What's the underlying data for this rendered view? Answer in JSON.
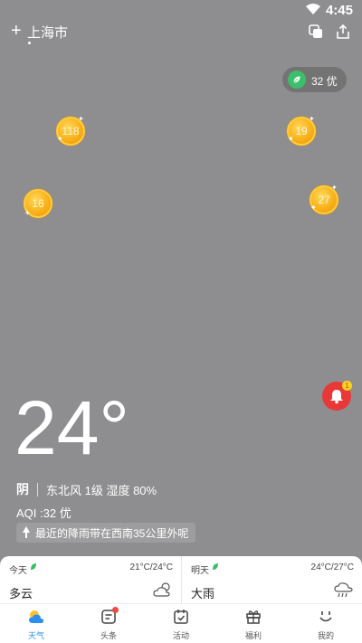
{
  "status_bar": {
    "time": "4:45"
  },
  "header": {
    "add_label": "+",
    "city": "上海市"
  },
  "aqi_badge": {
    "text": "32 优"
  },
  "coins": [
    "118",
    "19",
    "16",
    "27"
  ],
  "notification_count": "1",
  "current": {
    "temperature": "24°",
    "condition": "阴",
    "details": "东北风 1级 湿度 80%",
    "aqi": "AQI :32 优",
    "rain_notice": "最近的降雨带在西南35公里外呢"
  },
  "forecast": [
    {
      "day": "今天",
      "range": "21°C/24°C",
      "condition": "多云",
      "icon": "partly-cloudy-icon"
    },
    {
      "day": "明天",
      "range": "24°C/27°C",
      "condition": "大雨",
      "icon": "heavy-rain-icon"
    }
  ],
  "nav": [
    {
      "label": "天气",
      "icon": "weather-icon",
      "active": true
    },
    {
      "label": "头条",
      "icon": "news-icon"
    },
    {
      "label": "活动",
      "icon": "calendar-icon"
    },
    {
      "label": "福利",
      "icon": "gift-icon"
    },
    {
      "label": "我的",
      "icon": "smiley-icon"
    }
  ],
  "colors": {
    "accent": "#2d8cf0",
    "aqi_green": "#3cbf6b",
    "bell_red": "#e83838",
    "coin_gold": "#f8b21a"
  }
}
